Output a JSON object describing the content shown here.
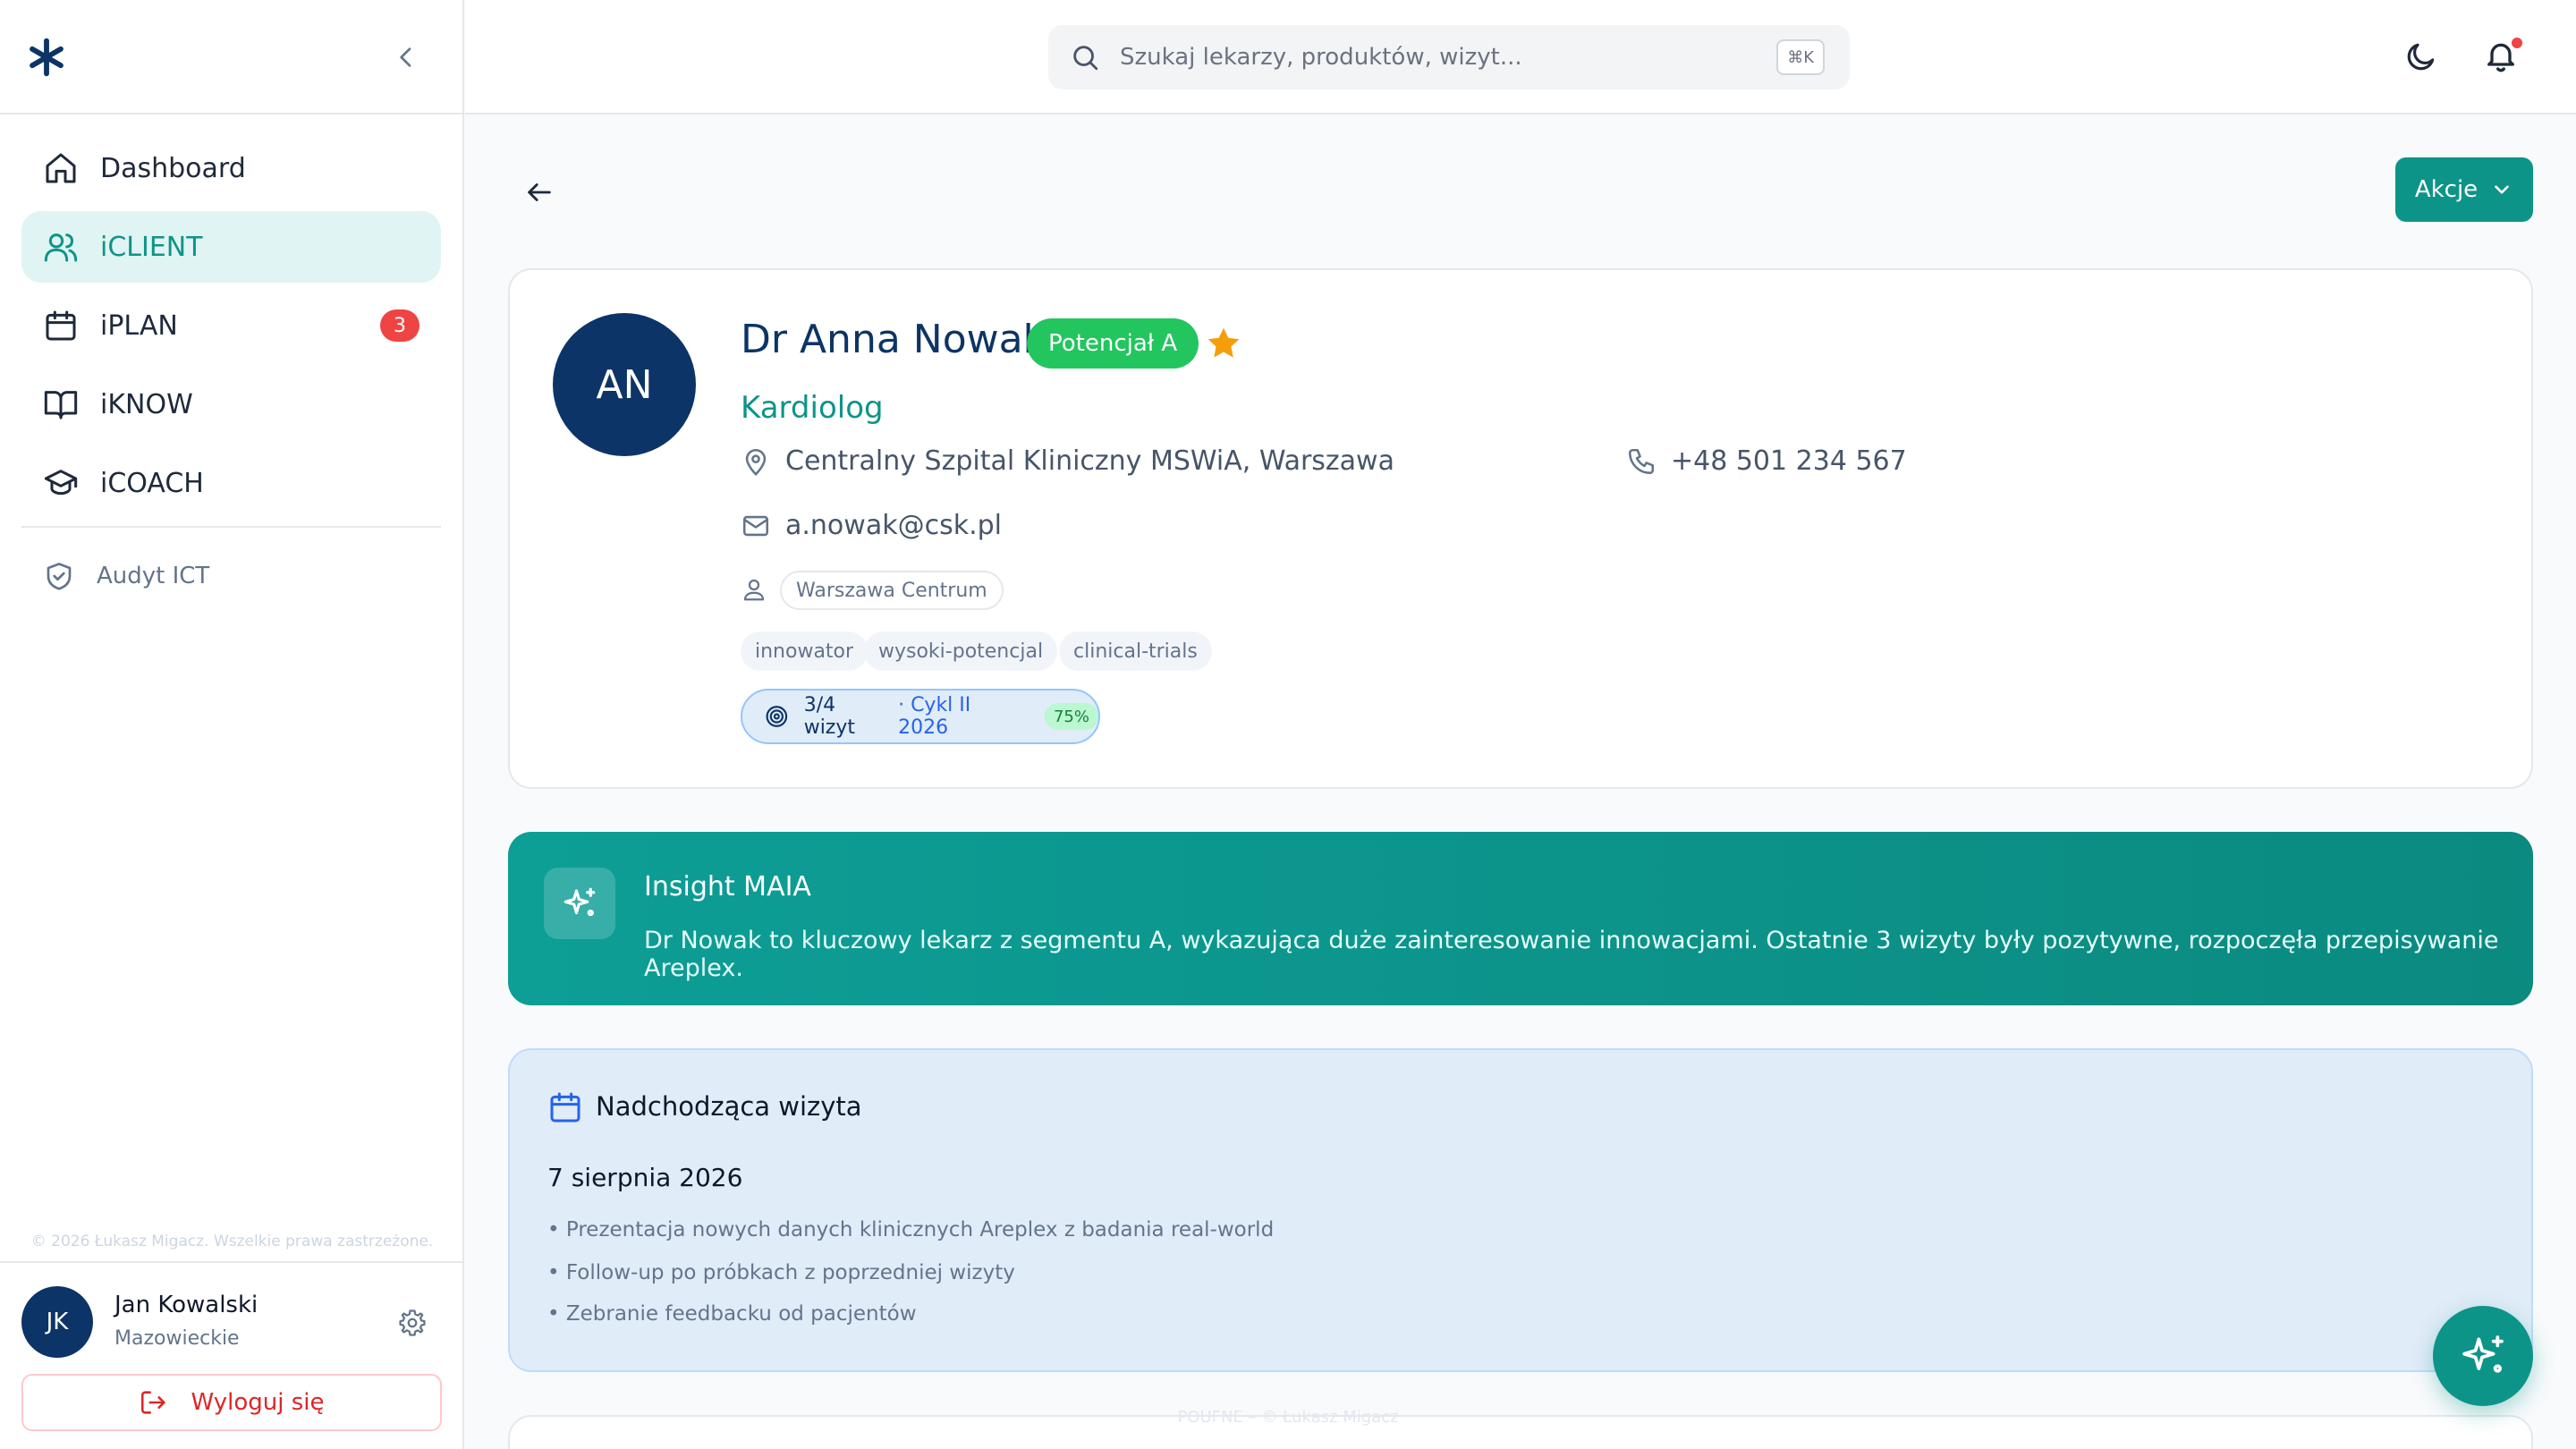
{
  "sidebar": {
    "items": [
      {
        "label": "Dashboard",
        "icon": "home-icon"
      },
      {
        "label": "iCLIENT",
        "icon": "users-icon",
        "active": true
      },
      {
        "label": "iPLAN",
        "icon": "calendar-icon",
        "badge": "3"
      },
      {
        "label": "iKNOW",
        "icon": "book-icon"
      },
      {
        "label": "iCOACH",
        "icon": "graduation-cap-icon"
      }
    ],
    "secondary": {
      "label": "Audyt ICT",
      "icon": "shield-icon"
    },
    "copyright": "© 2026 Łukasz Migacz. Wszelkie prawa zastrzeżone.",
    "user": {
      "initials": "JK",
      "name": "Jan Kowalski",
      "region": "Mazowieckie"
    },
    "logout_label": "Wyloguj się"
  },
  "header": {
    "search_placeholder": "Szukaj lekarzy, produktów, wizyt...",
    "shortcut": "⌘K"
  },
  "actions_label": "Akcje",
  "doctor": {
    "initials": "AN",
    "name": "Dr Anna Nowak",
    "potential": "Potencjał A",
    "specialty": "Kardiolog",
    "hospital": "Centralny Szpital Kliniczny MSWiA, Warszawa",
    "phone": "+48 501 234 567",
    "email": "a.nowak@csk.pl",
    "territory": "Warszawa Centrum",
    "tags": [
      "innowator",
      "wysoki-potencjal",
      "clinical-trials"
    ],
    "visits": {
      "count": "3/4 wizyt",
      "cycle": "· Cykl II 2026",
      "percent": "75%"
    }
  },
  "insight": {
    "title": "Insight MAIA",
    "text": "Dr Nowak to kluczowy lekarz z segmentu A, wykazująca duże zainteresowanie innowacjami. Ostatnie 3 wizyty były pozytywne, rozpoczęła przepisywanie Areplex."
  },
  "upcoming": {
    "title": "Nadchodząca wizyta",
    "date": "7 sierpnia 2026",
    "items": [
      "• Prezentacja nowych danych klinicznych Areplex z badania real-world",
      "• Follow-up po próbkach z poprzedniej wizyty",
      "• Zebranie feedbacku od pacjentów"
    ]
  },
  "watermark": "POUFNE – © Łukasz Migacz",
  "colors": {
    "accent": "#0d9488",
    "navy": "#0c3466",
    "success": "#22c55e",
    "danger": "#ef4444",
    "star": "#f59e0b"
  }
}
